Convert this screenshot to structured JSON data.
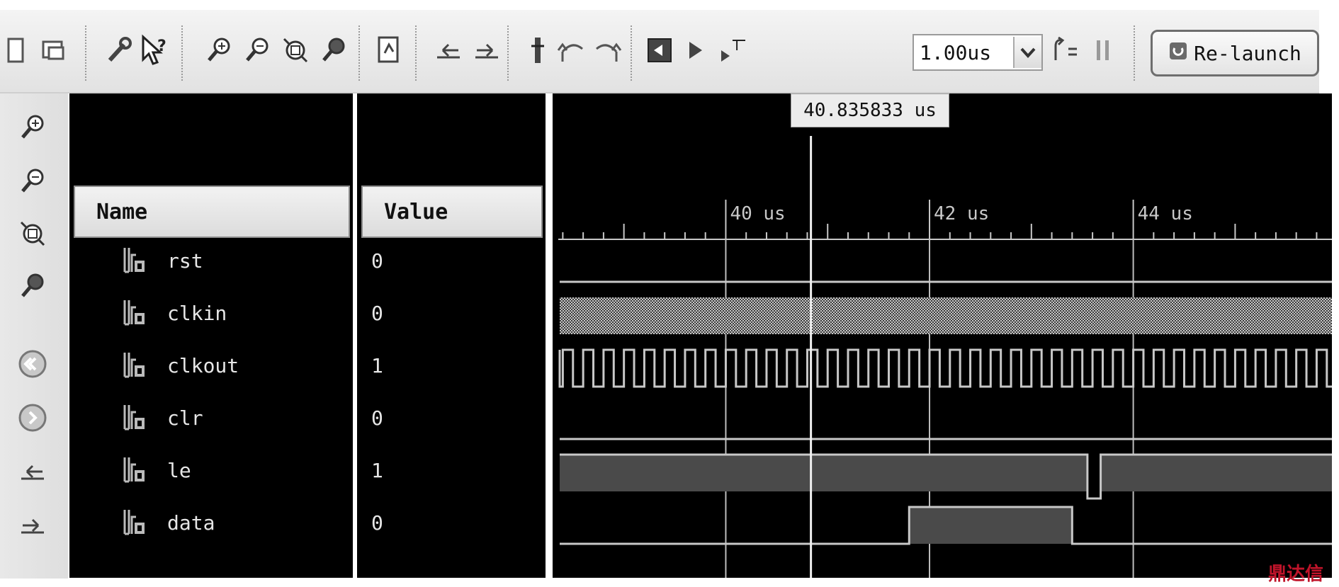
{
  "toolbar": {
    "time_value": "1.00us",
    "relaunch_label": "Re-launch",
    "icons": [
      "window-icon",
      "restore-icon",
      "wrench-icon",
      "help-cursor-icon",
      "zoom-in-icon",
      "zoom-out-icon",
      "zoom-fit-icon",
      "zoom-cursor-icon",
      "document-icon",
      "go-to-start-icon",
      "go-to-end-icon",
      "marker-icon",
      "previous-transition-icon",
      "next-transition-icon",
      "restart-icon",
      "run-icon",
      "run-for-time-icon",
      "step-icon",
      "pause-icon",
      "relaunch-icon"
    ]
  },
  "vertical_toolbar": {
    "icons": [
      "zoom-in-icon",
      "zoom-out-icon",
      "zoom-fit-icon",
      "zoom-cursor-icon",
      "go-back-icon",
      "go-forward-icon",
      "go-to-start-icon",
      "go-to-end-icon"
    ]
  },
  "cursor": {
    "time_label": "40.835833 us",
    "time_us": 40.835833
  },
  "columns": {
    "name_header": "Name",
    "value_header": "Value"
  },
  "timeline": {
    "tick_labels": [
      "40 us",
      "42 us",
      "44 us"
    ],
    "major_ticks_us": [
      40,
      42,
      44
    ],
    "range_us": [
      38.3,
      45.95
    ]
  },
  "signals": [
    {
      "name": "rst",
      "value": "0",
      "wave": "low"
    },
    {
      "name": "clkin",
      "value": "0",
      "wave": "fastclock"
    },
    {
      "name": "clkout",
      "value": "1",
      "wave": "clock",
      "period_us": 0.2
    },
    {
      "name": "clr",
      "value": "0",
      "wave": "low"
    },
    {
      "name": "le",
      "value": "1",
      "wave": "high",
      "pulses_low_us": [
        [
          43.55,
          43.68
        ]
      ]
    },
    {
      "name": "data",
      "value": "0",
      "wave": "low",
      "pulses_high_us": [
        [
          41.8,
          43.4
        ]
      ]
    }
  ],
  "watermark": "鼎达信",
  "colors": {
    "background": "#000000",
    "wave": "#c8c8c8",
    "bus_fill": "#4a4a4a",
    "grid": "#bdbdbd"
  }
}
